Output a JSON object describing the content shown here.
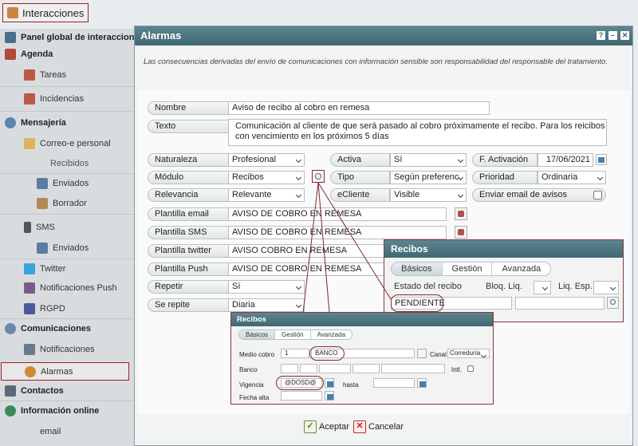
{
  "app": {
    "title": "Interacciones"
  },
  "sidebar": {
    "panel_global": "Panel global de interacciones",
    "agenda": "Agenda",
    "tareas": "Tareas",
    "incidencias": "Incidencias",
    "mensajeria": "Mensajería",
    "correo": "Correo-e personal",
    "recibidos": "Recibidos",
    "enviados": "Enviados",
    "borrador": "Borrador",
    "sms": "SMS",
    "sms_enviados": "Enviados",
    "twitter": "Twitter",
    "push": "Notificaciones Push",
    "rgpd": "RGPD",
    "comunicaciones": "Comunicaciones",
    "notificaciones": "Notificaciones",
    "alarmas": "Alarmas",
    "contactos": "Contactos",
    "info_online": "Información online",
    "email": "email"
  },
  "dialog": {
    "title": "Alarmas",
    "help": "?",
    "disclaimer": "Las consecuencias derivadas del envío de comunicaciones con información sensible son responsabilidad del responsable del tratamiento.",
    "fields": {
      "nombre_label": "Nombre",
      "nombre_value": "Aviso de recibo al cobro en remesa",
      "texto_label": "Texto",
      "texto_value": "Comunicación al cliente de que será pasado al cobro próximamente el recibo. Para los reicibos con vencimiento en los próximos 5 días",
      "naturaleza_label": "Naturaleza",
      "naturaleza_value": "Profesional",
      "activa_label": "Activa",
      "activa_value": "Sí",
      "factivacion_label": "F. Activación",
      "factivacion_value": "17/06/2021",
      "modulo_label": "Módulo",
      "modulo_value": "Recibos",
      "tipo_label": "Tipo",
      "tipo_value": "Según preferenc",
      "prioridad_label": "Prioridad",
      "prioridad_value": "Ordinaria",
      "relevancia_label": "Relevancia",
      "relevancia_value": "Relevante",
      "ecliente_label": "eCliente",
      "ecliente_value": "Visible",
      "enviar_email_label": "Enviar email de avisos",
      "plantilla_email_label": "Plantilla email",
      "plantilla_email_value": "AVISO DE COBRO EN REMESA",
      "plantilla_sms_label": "Plantilla SMS",
      "plantilla_sms_value": "AVISO DE COBRO EN REMESA",
      "plantilla_twitter_label": "Plantilla twitter",
      "plantilla_twitter_value": "AVISO COBRO EN REMESA",
      "plantilla_push_label": "Plantilla Push",
      "plantilla_push_value": "AVISO DE COBRO EN REMESA",
      "repetir_label": "Repetir",
      "repetir_value": "Sí",
      "se_repite_label": "Se repite",
      "se_repite_value": "Diaria"
    },
    "accept": "Aceptar",
    "cancel": "Cancelar"
  },
  "recibos_large": {
    "title": "Recibos",
    "tabs": [
      "Básicos",
      "Gestión",
      "Avanzada"
    ],
    "estado_label": "Estado del recibo",
    "bloq_label": "Bloq. Liq.",
    "liq_label": "Liq. Esp.",
    "estado_value": "PENDIENTE"
  },
  "recibos_small": {
    "title": "Recibos",
    "tabs": [
      "Básicos",
      "Gestión",
      "Avanzada"
    ],
    "medio_cobro_label": "Medio cobro",
    "medio_cobro_code": "1",
    "medio_cobro_value": "BANCO",
    "canal_label": "Canal",
    "canal_value": "Correduría",
    "banco_label": "Banco",
    "intl_label": "Intl.",
    "vigencia_label": "Vigencia",
    "vigencia_value": "@DOSD@",
    "hasta_label": "hasta",
    "fecha_alta_label": "Fecha alta"
  }
}
